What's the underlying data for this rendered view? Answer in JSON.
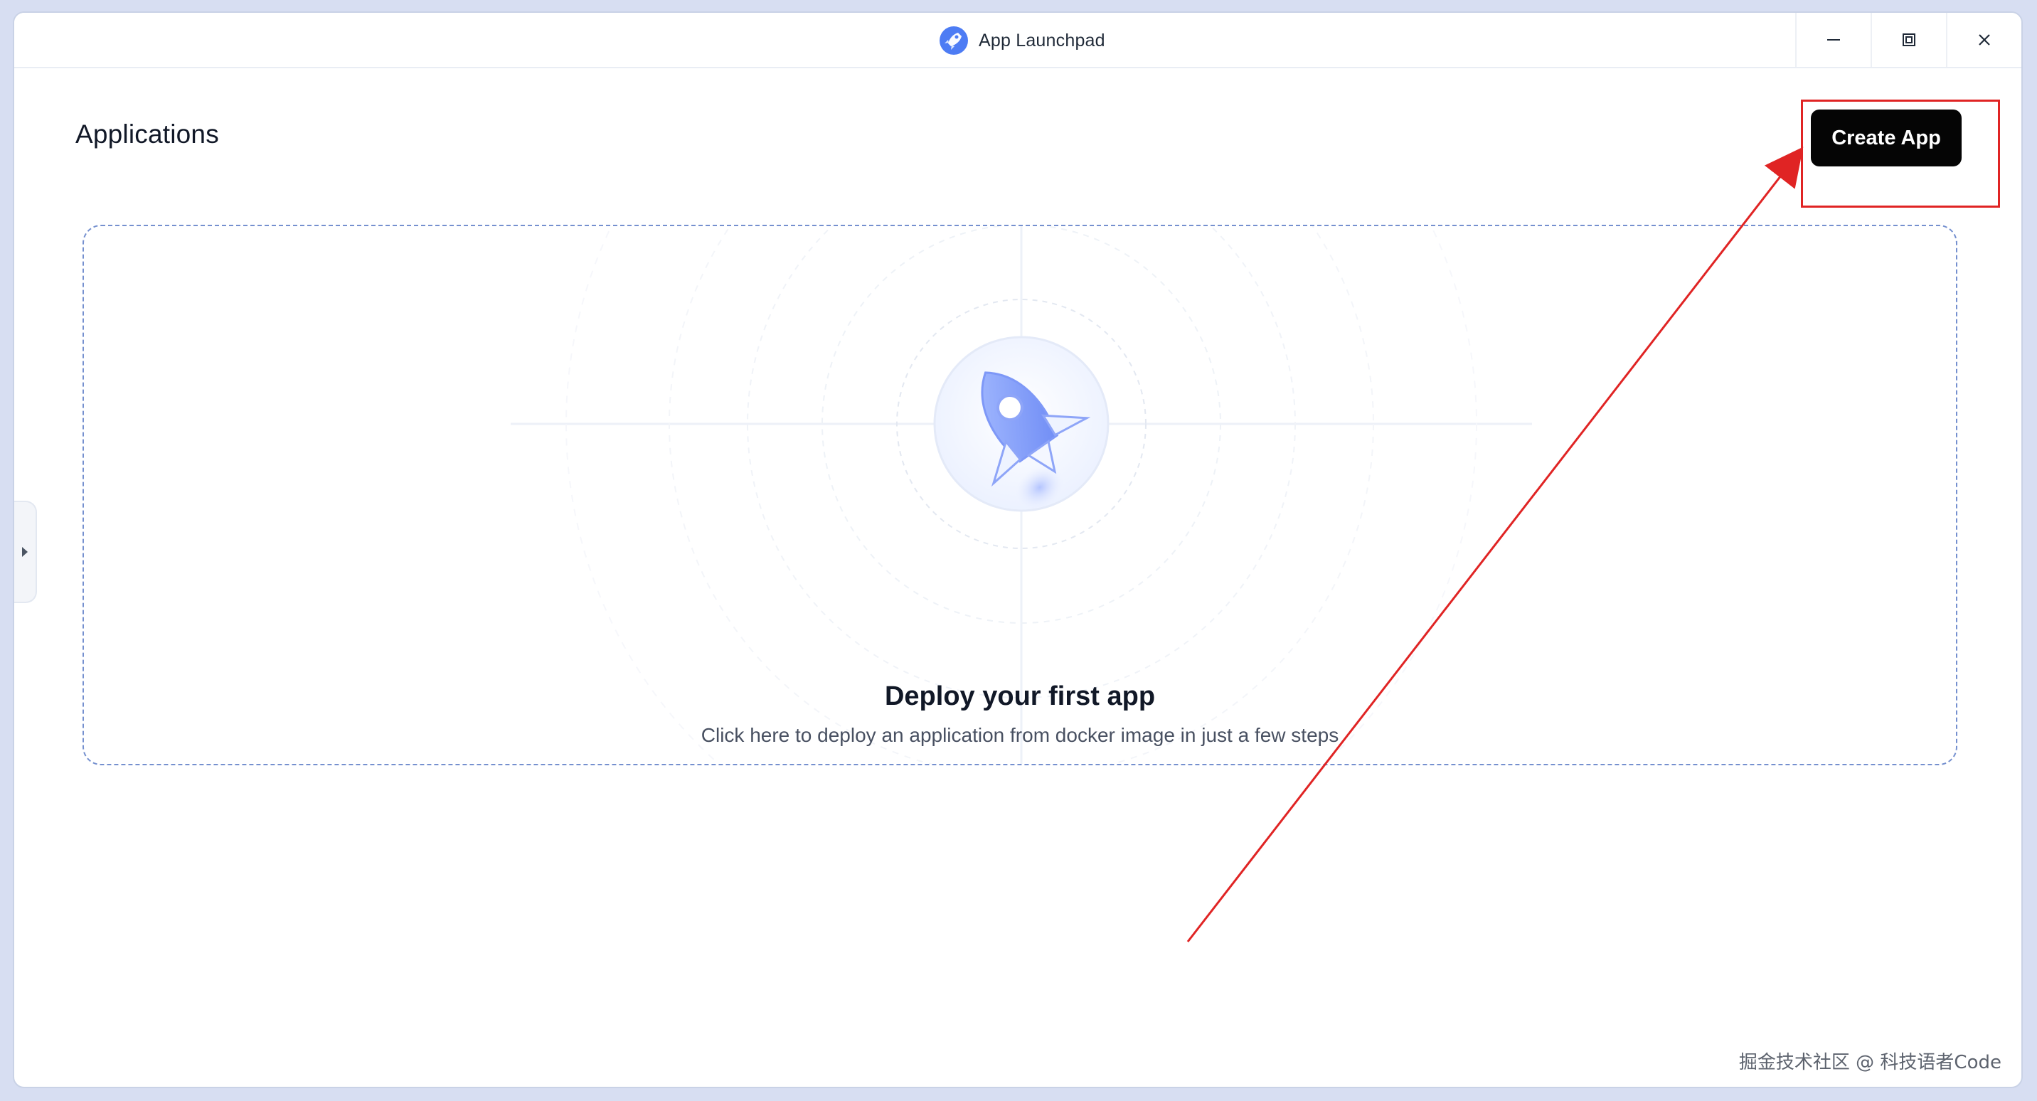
{
  "window": {
    "title": "App Launchpad"
  },
  "header": {
    "title": "Applications",
    "create_label": "Create App"
  },
  "empty_state": {
    "title": "Deploy your first app",
    "subtitle": "Click here to deploy an application from docker image in just a few steps"
  },
  "icons": {
    "app_logo": "rocket-icon",
    "minimize": "minimize-icon",
    "maximize": "maximize-icon",
    "close": "close-icon",
    "sidebar_toggle": "chevron-right-icon",
    "illustration": "rocket-icon"
  },
  "watermark": {
    "text": "掘金技术社区 @ 科技语者Code"
  },
  "colors": {
    "primary_button": "#050505",
    "annotation": "#e02424",
    "accent": "#7d95f7"
  }
}
